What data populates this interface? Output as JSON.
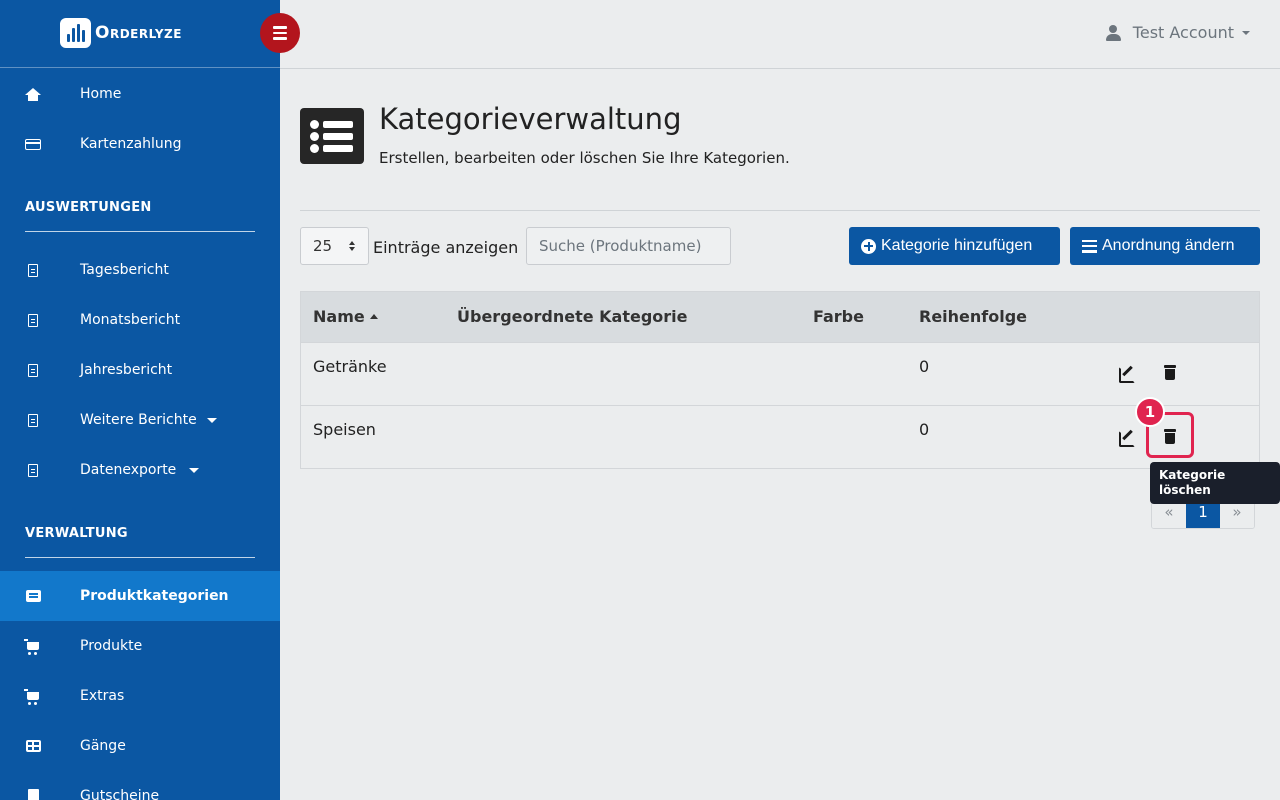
{
  "brand": {
    "name": "Orderlyze"
  },
  "sidebar": {
    "top_items": [
      {
        "label": "Home",
        "icon": "home-icon"
      },
      {
        "label": "Kartenzahlung",
        "icon": "credit-card-icon"
      }
    ],
    "sections": [
      {
        "title": "AUSWERTUNGEN",
        "items": [
          {
            "label": "Tagesbericht",
            "icon": "file-icon"
          },
          {
            "label": "Monatsbericht",
            "icon": "file-icon"
          },
          {
            "label": "Jahresbericht",
            "icon": "file-icon"
          },
          {
            "label": "Weitere Berichte",
            "icon": "file-icon",
            "dropdown": true
          },
          {
            "label": "Datenexporte",
            "icon": "file-icon",
            "dropdown": true
          }
        ]
      },
      {
        "title": "VERWALTUNG",
        "items": [
          {
            "label": "Produktkategorien",
            "icon": "list-alt-icon",
            "active": true
          },
          {
            "label": "Produkte",
            "icon": "cart-icon"
          },
          {
            "label": "Extras",
            "icon": "cart-plus-icon"
          },
          {
            "label": "Gänge",
            "icon": "table-icon"
          },
          {
            "label": "Gutscheine",
            "icon": "file-solid-icon"
          }
        ]
      }
    ]
  },
  "topbar": {
    "account_label": "Test Account"
  },
  "header": {
    "title": "Kategorieverwaltung",
    "subtitle": "Erstellen, bearbeiten oder löschen Sie Ihre Kategorien."
  },
  "controls": {
    "page_size": "25",
    "entries_label": "Einträge anzeigen",
    "search_placeholder": "Suche (Produktname)",
    "add_button": "Kategorie hinzufügen",
    "order_button": "Anordnung ändern"
  },
  "table": {
    "columns": [
      "Name",
      "Übergeordnete Kategorie",
      "Farbe",
      "Reihenfolge"
    ],
    "rows": [
      {
        "name": "Getränke",
        "parent": "",
        "color": "",
        "order": "0"
      },
      {
        "name": "Speisen",
        "parent": "",
        "color": "",
        "order": "0"
      }
    ]
  },
  "pagination": {
    "prev": "«",
    "current": "1",
    "next": "»"
  },
  "tooltip": {
    "text": "Kategorie löschen"
  },
  "annotation": {
    "step": "1"
  },
  "colors": {
    "sidebar_bg": "#0b57a3",
    "active_item": "#1278cb",
    "primary": "#0b57a3",
    "toggle": "#b3151d",
    "highlight": "#e0244f"
  }
}
